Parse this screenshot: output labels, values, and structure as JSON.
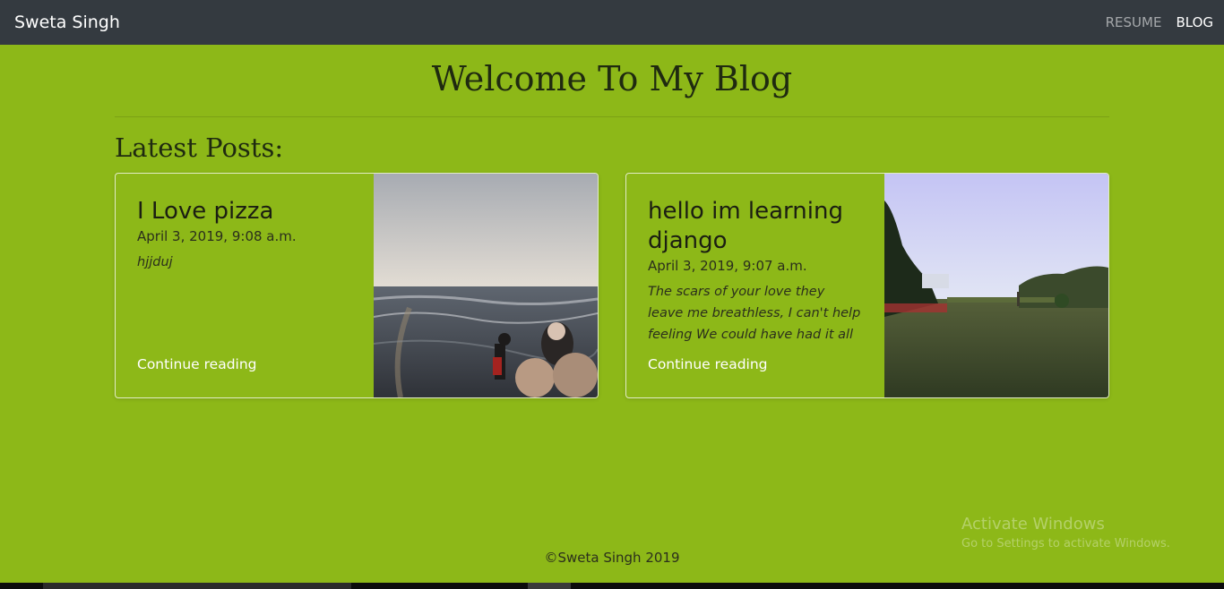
{
  "navbar": {
    "brand": "Sweta Singh",
    "links": [
      {
        "label": "RESUME",
        "active": false
      },
      {
        "label": "BLOG",
        "active": true
      }
    ]
  },
  "page": {
    "title": "Welcome To My Blog",
    "section_title": "Latest Posts:"
  },
  "posts": [
    {
      "title": "I Love pizza",
      "date": "April 3, 2019, 9:08 a.m.",
      "excerpt": "hjjduj",
      "link_label": "Continue reading",
      "image": "beach-photo"
    },
    {
      "title": "hello im learning django",
      "date": "April 3, 2019, 9:07 a.m.",
      "excerpt": "The scars of your love they leave me breathless, I can't help feeling We could have had it all (you",
      "link_label": "Continue reading",
      "image": "park-photo"
    }
  ],
  "footer": {
    "copyright": "©Sweta Singh 2019"
  },
  "watermark": {
    "title": "Activate Windows",
    "subtitle": "Go to Settings to activate Windows."
  },
  "colors": {
    "background": "#8db818",
    "navbar": "#343a40",
    "link": "#ffffff"
  }
}
